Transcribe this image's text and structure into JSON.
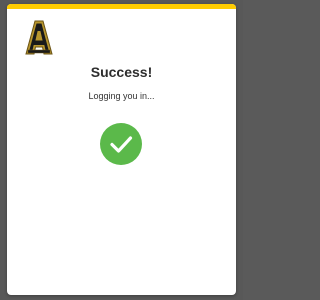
{
  "colors": {
    "accent_bar": "#ffcc00",
    "success_green": "#5bb94a",
    "logo_gold": "#b8962e"
  },
  "branding": {
    "logo_icon": "appalachian-a-logo-icon"
  },
  "status": {
    "title": "Success!",
    "message": "Logging you in...",
    "icon": "checkmark-circle-icon"
  }
}
